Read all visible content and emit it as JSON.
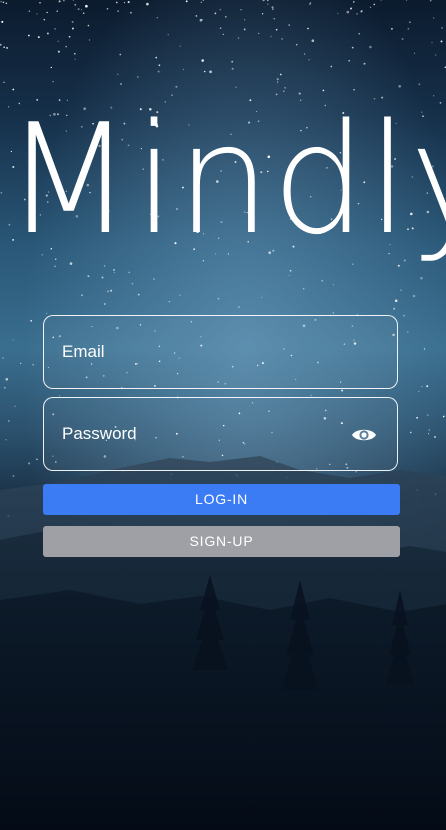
{
  "app": {
    "logo_text": "Mindly"
  },
  "form": {
    "email_placeholder": "Email",
    "email_value": "",
    "password_placeholder": "Password",
    "password_value": "",
    "visibility_icon": "eye-icon"
  },
  "buttons": {
    "login_label": "LOG-IN",
    "signup_label": "SIGN-UP"
  },
  "colors": {
    "login": "#3b7cf5",
    "signup": "#9ea0a5",
    "text": "#ffffff"
  }
}
